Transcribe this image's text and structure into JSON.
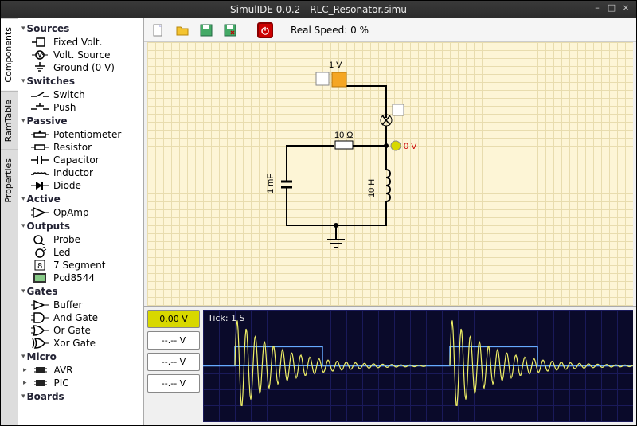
{
  "window": {
    "title": "SimulIDE 0.0.2  -  RLC_Resonator.simu"
  },
  "vtabs": [
    {
      "label": "Components",
      "active": true
    },
    {
      "label": "RamTable",
      "active": false
    },
    {
      "label": "Properties",
      "active": false
    }
  ],
  "sidebar": [
    {
      "cat": "Sources",
      "items": [
        "Fixed Volt.",
        "Volt. Source",
        "Ground (0 V)"
      ]
    },
    {
      "cat": "Switches",
      "items": [
        "Switch",
        "Push"
      ]
    },
    {
      "cat": "Passive",
      "items": [
        "Potentiometer",
        "Resistor",
        "Capacitor",
        "Inductor",
        "Diode"
      ]
    },
    {
      "cat": "Active",
      "items": [
        "OpAmp"
      ]
    },
    {
      "cat": "Outputs",
      "items": [
        "Probe",
        "Led",
        "7 Segment",
        "Pcd8544"
      ]
    },
    {
      "cat": "Gates",
      "items": [
        "Buffer",
        "And Gate",
        "Or Gate",
        "Xor Gate"
      ]
    },
    {
      "cat": "Micro",
      "items": [
        "AVR",
        "PIC"
      ]
    },
    {
      "cat": "Boards",
      "items": []
    }
  ],
  "toolbar": {
    "speed_label": "Real Speed: 0 %"
  },
  "circuit": {
    "v_source": "1 V",
    "resistor": "10 Ω",
    "capacitor": "1 mF",
    "inductor": "10 H",
    "probe": "0 V"
  },
  "scope": {
    "tick": "Tick: 1 S",
    "channels": [
      {
        "value": "0.00 V",
        "active": true
      },
      {
        "value": "--.-- V",
        "active": false
      },
      {
        "value": "--.-- V",
        "active": false
      },
      {
        "value": "--.-- V",
        "active": false
      }
    ]
  }
}
